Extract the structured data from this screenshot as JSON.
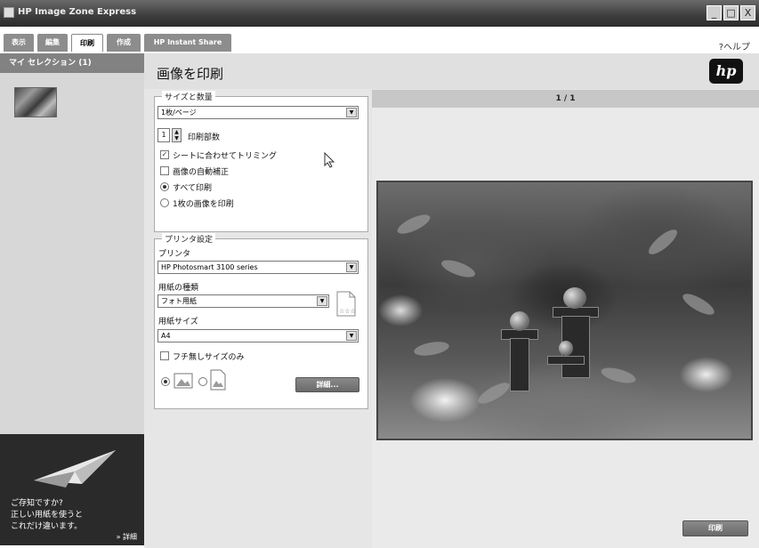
{
  "window": {
    "title": "HP Image Zone Express",
    "minimize": "_",
    "maximize": "□",
    "close": "X"
  },
  "tabs": [
    {
      "label": "表示",
      "active": false
    },
    {
      "label": "編集",
      "active": false
    },
    {
      "label": "印刷",
      "active": true
    },
    {
      "label": "作成",
      "active": false
    },
    {
      "label": "HP Instant Share",
      "active": false
    }
  ],
  "help": {
    "label": "ヘルプ",
    "icon": "help-icon"
  },
  "left_panel": {
    "header": "マイ セレクション (1)",
    "tip": {
      "lines": [
        "ご存知ですか?",
        "正しい用紙を使うと",
        "これだけ違います。"
      ],
      "more": "» 詳細"
    }
  },
  "main": {
    "title": "画像を印刷",
    "logo": "hp"
  },
  "size_quantity": {
    "title": "サイズと数量",
    "layout_select": "1枚/ページ",
    "copies_value": "1",
    "copies_label": "印刷部数",
    "fit_to_sheet_label": "シートに合わせてトリミング",
    "fit_to_sheet_checked": true,
    "auto_fix_label": "画像の自動補正",
    "auto_fix_checked": false,
    "print_all_label": "すべて印刷",
    "print_one_label": "1枚の画像を印刷",
    "selected_radio": "print_all"
  },
  "printer_settings": {
    "title": "プリンタ設定",
    "printer_label": "プリンタ",
    "printer_value": "HP Photosmart 3100 series",
    "paper_type_label": "用紙の種類",
    "paper_type_value": "フォト用紙",
    "paper_size_label": "用紙サイズ",
    "paper_size_value": "A4",
    "borderless_label": "フチ無しサイズのみ",
    "borderless_checked": false,
    "orientation": "landscape",
    "details_button": "詳細..."
  },
  "preview": {
    "page_indicator": "1 / 1",
    "print_button": "印刷"
  }
}
